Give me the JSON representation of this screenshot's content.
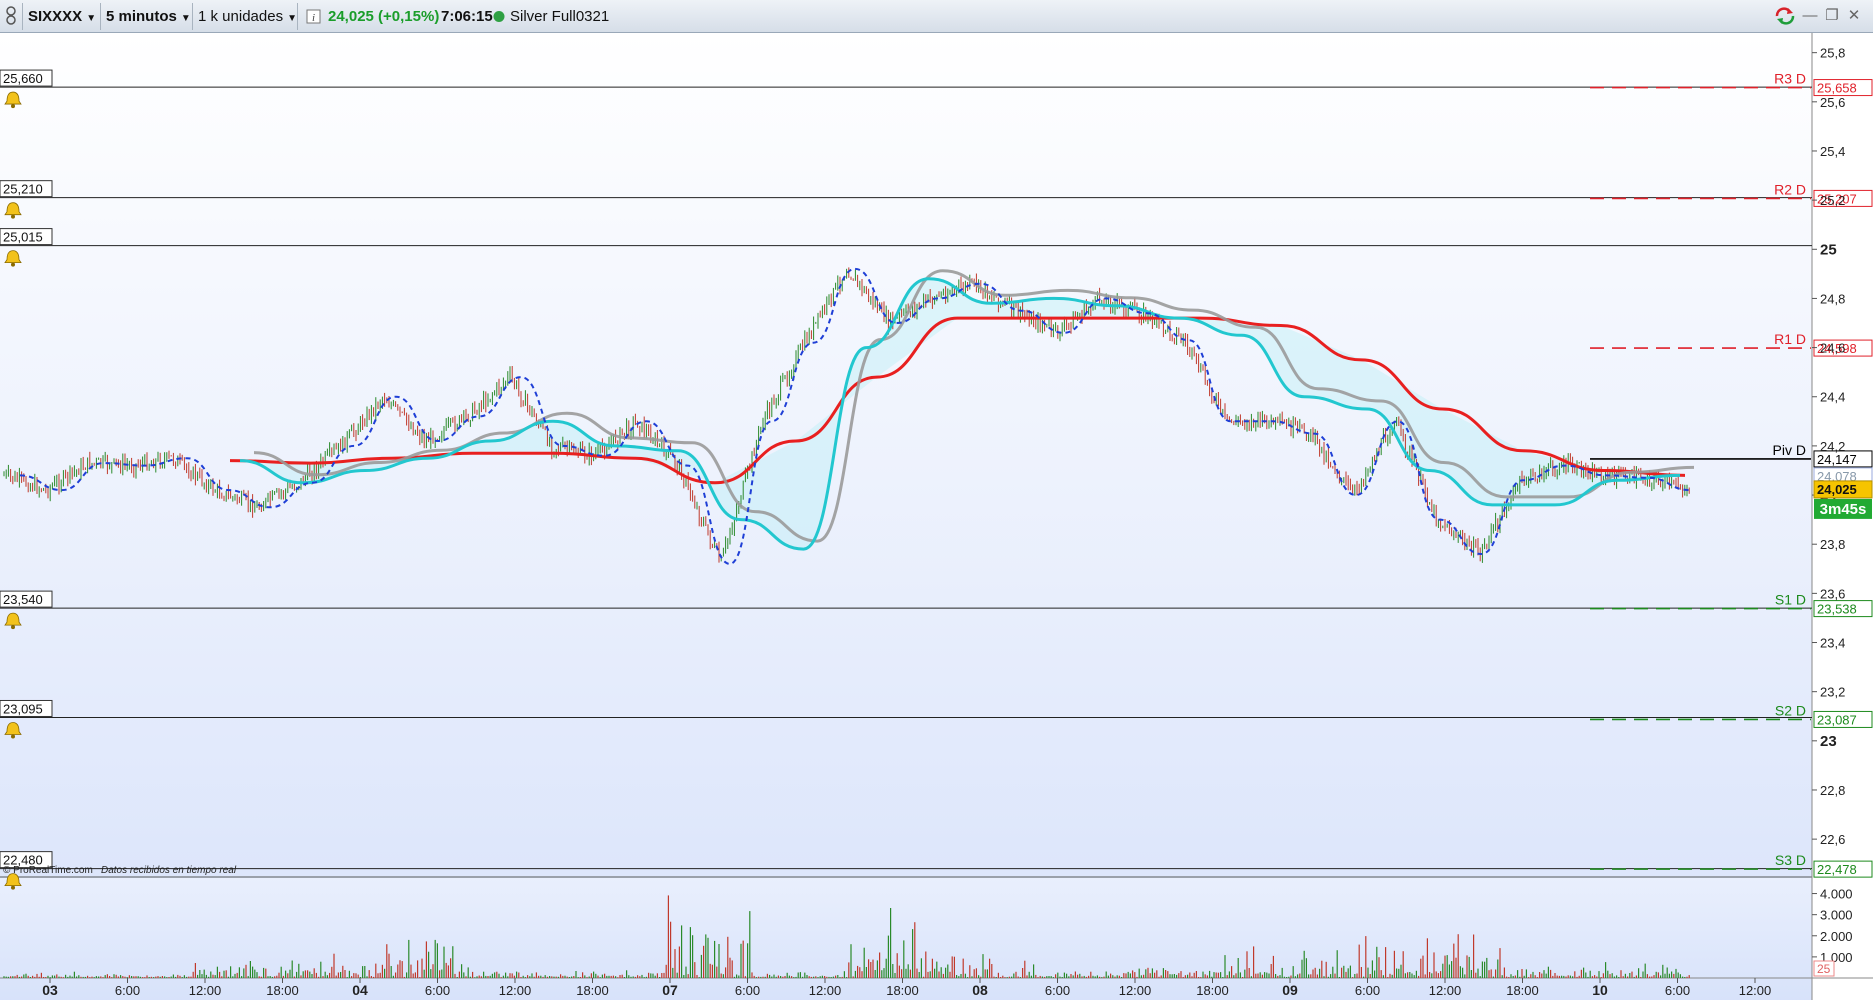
{
  "toolbar": {
    "symbol": "SIXXXX",
    "timeframe": "5 minutos",
    "units": "1 k unidades",
    "info_icon": "info-icon",
    "price": "24,025 (+0,15%)",
    "time": "7:06:15",
    "account": "Silver Full0321",
    "colors": {
      "price": "#1a9d2a",
      "status": "#2ea043"
    }
  },
  "chart": {
    "y_ticks": [
      "25,8",
      "25,6",
      "25,4",
      "25,2",
      "25",
      "24,8",
      "24,6",
      "24,4",
      "24,2",
      "24",
      "23,8",
      "23,6",
      "23,4",
      "23,2",
      "23",
      "22,8",
      "22,6"
    ],
    "y_range": [
      22.45,
      25.88
    ],
    "x_ticks": [
      "03",
      "6:00",
      "12:00",
      "18:00",
      "04",
      "6:00",
      "12:00",
      "18:00",
      "07",
      "6:00",
      "12:00",
      "18:00",
      "08",
      "6:00",
      "12:00",
      "18:00",
      "09",
      "6:00",
      "12:00",
      "18:00",
      "10",
      "6:00",
      "12:00"
    ],
    "alert_lines": [
      {
        "value": 25.66,
        "label": "25,660"
      },
      {
        "value": 25.21,
        "label": "25,210"
      },
      {
        "value": 25.015,
        "label": "25,015"
      },
      {
        "value": 23.54,
        "label": "23,540"
      },
      {
        "value": 23.095,
        "label": "23,095"
      },
      {
        "value": 22.48,
        "label": "22,480"
      }
    ],
    "pivots": [
      {
        "name": "R3 D",
        "value": 25.658,
        "label": "25,658",
        "color": "#e0202a"
      },
      {
        "name": "R2 D",
        "value": 25.207,
        "label": "25,207",
        "color": "#e0202a"
      },
      {
        "name": "R1 D",
        "value": 24.598,
        "label": "24,598",
        "color": "#e0202a"
      },
      {
        "name": "Piv D",
        "value": 24.147,
        "label": "24,147",
        "color": "#000000"
      },
      {
        "name": "S1 D",
        "value": 23.538,
        "label": "23,538",
        "color": "#1c8a1c"
      },
      {
        "name": "S2 D",
        "value": 23.087,
        "label": "23,087",
        "color": "#1c8a1c"
      },
      {
        "name": "S3 D",
        "value": 22.478,
        "label": "22,478",
        "color": "#1c8a1c"
      }
    ],
    "price_marker": {
      "value": 24.025,
      "label": "24,025"
    },
    "ma_marker": {
      "value": 24.078,
      "label": "24,078"
    },
    "countdown": "3m45s",
    "watermark": "© ProRealTime.com",
    "watermark_note": "Datos recibidos en tiempo real"
  },
  "volume": {
    "y_ticks": [
      "4.000",
      "3.000",
      "2.000",
      "1.000"
    ],
    "y_range": [
      0,
      4500
    ],
    "current_label": "25"
  },
  "chart_data": {
    "type": "line",
    "x": [
      "03",
      "04",
      "07",
      "08",
      "09",
      "10"
    ],
    "price_path": [
      24.08,
      24.02,
      24.13,
      24.12,
      24.15,
      24.02,
      23.95,
      24.05,
      24.2,
      24.4,
      24.22,
      24.32,
      24.48,
      24.2,
      24.16,
      24.3,
      24.12,
      23.72,
      24.3,
      24.62,
      24.92,
      24.7,
      24.8,
      24.86,
      24.75,
      24.66,
      24.8,
      24.74,
      24.63,
      24.3,
      24.3,
      24.25,
      24.0,
      24.3,
      23.9,
      23.76,
      24.06,
      24.12,
      24.08,
      24.07,
      24.02
    ],
    "ma_fast": [
      24.14,
      24.05,
      24.1,
      24.15,
      24.22,
      24.3,
      24.2,
      24.18,
      23.9,
      23.78,
      24.6,
      24.88,
      24.78,
      24.8,
      24.77,
      24.72,
      24.65,
      24.4,
      24.35,
      24.1,
      23.96,
      23.96,
      24.06,
      24.08
    ],
    "ma_slow": [
      24.14,
      24.13,
      24.15,
      24.17,
      24.17,
      24.15,
      24.05,
      24.22,
      24.48,
      24.72,
      24.72,
      24.72,
      24.72,
      24.69,
      24.55,
      24.35,
      24.18,
      24.1,
      24.08
    ],
    "volume": [
      300,
      180,
      900,
      1200,
      2200,
      450,
      350,
      4100,
      300,
      3800,
      1300,
      400,
      700,
      1600,
      2600,
      2800,
      600,
      800
    ],
    "ylim": [
      22.45,
      25.88
    ]
  }
}
